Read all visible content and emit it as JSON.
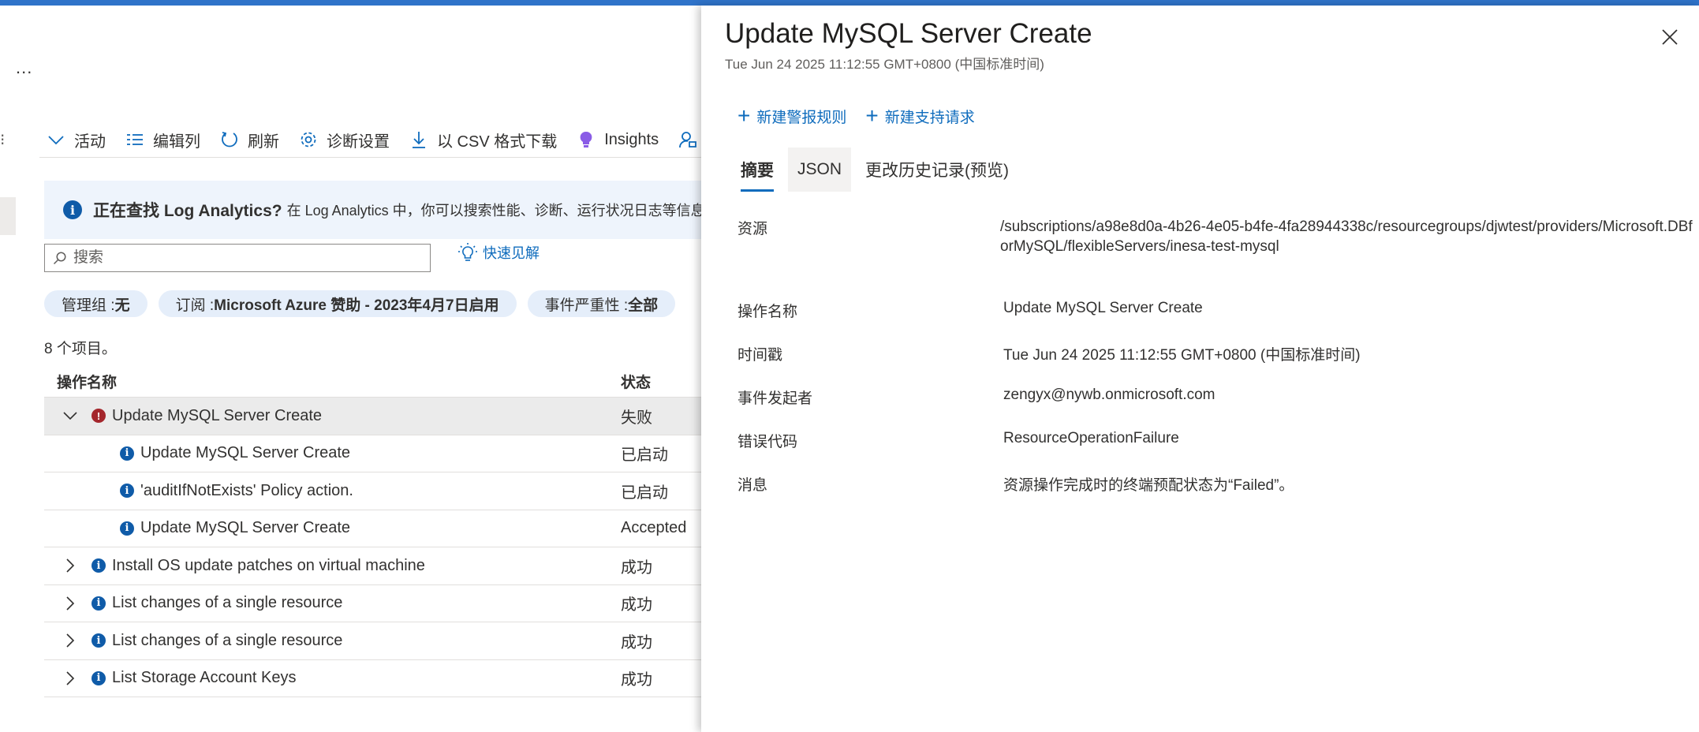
{
  "left": {
    "ellipsis": "...",
    "edge_mark": "⁝",
    "toolbar": [
      {
        "name": "activity",
        "label": "活动",
        "icon": "chevron-down-icon"
      },
      {
        "name": "edit-columns",
        "label": "编辑列",
        "icon": "edit-columns-icon"
      },
      {
        "name": "refresh",
        "label": "刷新",
        "icon": "refresh-icon"
      },
      {
        "name": "diagnostic-settings",
        "label": "诊断设置",
        "icon": "gear-icon"
      },
      {
        "name": "download-csv",
        "label": "以 CSV 格式下载",
        "icon": "download-icon"
      },
      {
        "name": "insights",
        "label": "Insights",
        "icon": "lightbulb-icon"
      },
      {
        "name": "feedback",
        "label": "",
        "icon": "feedback-icon"
      }
    ],
    "banner": {
      "title": "正在查找 Log Analytics?",
      "text": "在 Log Analytics 中，你可以搜索性能、诊断、运行状况日志等信息"
    },
    "search": {
      "placeholder": "搜索",
      "value": ""
    },
    "quick_insights": "快速见解",
    "filters": [
      {
        "key": "管理组 : ",
        "value": "无"
      },
      {
        "key": "订阅 : ",
        "value": "Microsoft Azure 赞助 - 2023年4月7日启用"
      },
      {
        "key": "事件严重性 : ",
        "value": "全部"
      }
    ],
    "items_count": "8 个项目。",
    "table": {
      "columns": [
        "操作名称",
        "状态"
      ],
      "rows": [
        {
          "name": "Update MySQL Server Create",
          "status": "失败",
          "severity": "error",
          "level": "parent",
          "expanded": true,
          "selected": true
        },
        {
          "name": "Update MySQL Server Create",
          "status": "已启动",
          "severity": "info",
          "level": "child"
        },
        {
          "name": "'auditIfNotExists' Policy action.",
          "status": "已启动",
          "severity": "info",
          "level": "child"
        },
        {
          "name": "Update MySQL Server Create",
          "status": "Accepted",
          "severity": "info",
          "level": "child"
        },
        {
          "name": "Install OS update patches on virtual machine",
          "status": "成功",
          "severity": "info",
          "level": "parent",
          "expanded": false
        },
        {
          "name": "List changes of a single resource",
          "status": "成功",
          "severity": "info",
          "level": "parent",
          "expanded": false
        },
        {
          "name": "List changes of a single resource",
          "status": "成功",
          "severity": "info",
          "level": "parent",
          "expanded": false
        },
        {
          "name": "List Storage Account Keys",
          "status": "成功",
          "severity": "info",
          "level": "parent",
          "expanded": false
        }
      ]
    }
  },
  "panel": {
    "title": "Update MySQL Server Create",
    "subtitle": "Tue Jun 24 2025 11:12:55 GMT+0800 (中国标准时间)",
    "actions": [
      {
        "name": "new-alert-rule",
        "label": "新建警报规则"
      },
      {
        "name": "new-support-request",
        "label": "新建支持请求"
      }
    ],
    "tabs": [
      {
        "name": "summary",
        "label": "摘要",
        "active": true
      },
      {
        "name": "json",
        "label": "JSON",
        "hover": true
      },
      {
        "name": "change-history",
        "label": "更改历史记录(预览)"
      }
    ],
    "details": [
      {
        "label": "资源",
        "value": "/subscriptions/a98e8d0a-4b26-4e05-b4fe-4fa28944338c/resourcegroups/djwtest/providers/Microsoft.DBforMySQL/flexibleServers/inesa-test-mysql"
      },
      {
        "label": "操作名称",
        "value": "Update MySQL Server Create"
      },
      {
        "label": "时间戳",
        "value": "Tue Jun 24 2025 11:12:55 GMT+0800 (中国标准时间)"
      },
      {
        "label": "事件发起者",
        "value": "zengyx@nywb.onmicrosoft.com"
      },
      {
        "label": "错误代码",
        "value": "ResourceOperationFailure"
      },
      {
        "label": "消息",
        "value": "资源操作完成时的终端预配状态为“Failed”。"
      }
    ]
  },
  "colors": {
    "accent": "#0f6cbd",
    "topbar": "#2f73c9",
    "error": "#a4262c",
    "info": "#0f5ba8",
    "pill": "#e5eefa",
    "banner": "#eef4fc"
  }
}
